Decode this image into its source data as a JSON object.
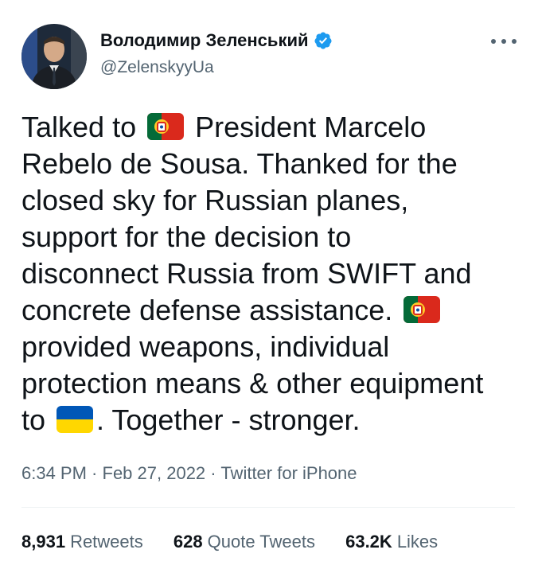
{
  "author": {
    "display_name": "Володимир Зеленський",
    "handle": "@ZelenskyyUa",
    "verified": true
  },
  "tweet": {
    "lines": [
      [
        "Talked to ",
        {
          "flag": "portugal"
        },
        " President Marcelo"
      ],
      [
        "Rebelo de Sousa. Thanked for the"
      ],
      [
        "closed sky for Russian planes,"
      ],
      [
        "support for the decision to"
      ],
      [
        "disconnect Russia from SWIFT and"
      ],
      [
        "concrete defense assistance. ",
        {
          "flag": "portugal"
        }
      ],
      [
        "provided weapons, individual"
      ],
      [
        "protection means & other equipment"
      ],
      [
        "to ",
        {
          "flag": "ukraine"
        },
        ". Together - stronger."
      ]
    ]
  },
  "meta": {
    "time": "6:34 PM",
    "separator": " · ",
    "date": "Feb 27, 2022",
    "source": "Twitter for iPhone"
  },
  "stats": {
    "retweets": {
      "count": "8,931",
      "label": "Retweets"
    },
    "quotes": {
      "count": "628",
      "label": "Quote Tweets"
    },
    "likes": {
      "count": "63.2K",
      "label": "Likes"
    }
  },
  "colors": {
    "text": "#0f1419",
    "secondary": "#536471",
    "verified": "#1d9bf0",
    "portugal_green": "#046a38",
    "portugal_red": "#da291c",
    "ukraine_blue": "#0057b7",
    "ukraine_yellow": "#ffd700"
  },
  "icons": {
    "verified": "verified-badge-icon",
    "more": "more-horizontal-icon"
  }
}
